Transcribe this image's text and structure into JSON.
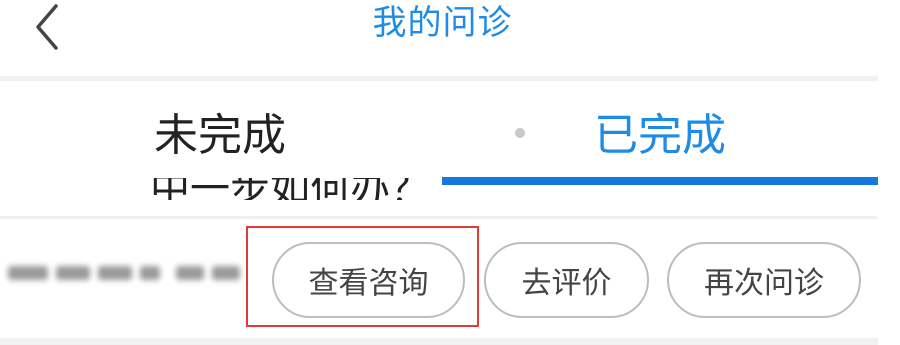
{
  "header": {
    "title": "我的问诊",
    "back_icon": "chevron-left-icon"
  },
  "tabs": [
    {
      "label": "未完成",
      "active": false
    },
    {
      "label": "已完成",
      "active": true
    }
  ],
  "clipped_text": "中一步如何办？",
  "actions": {
    "view_consultation": "查看咨询",
    "rate": "去评价",
    "consult_again": "再次问诊"
  },
  "colors": {
    "accent": "#1e8ce6",
    "highlight": "#e03a3a"
  }
}
